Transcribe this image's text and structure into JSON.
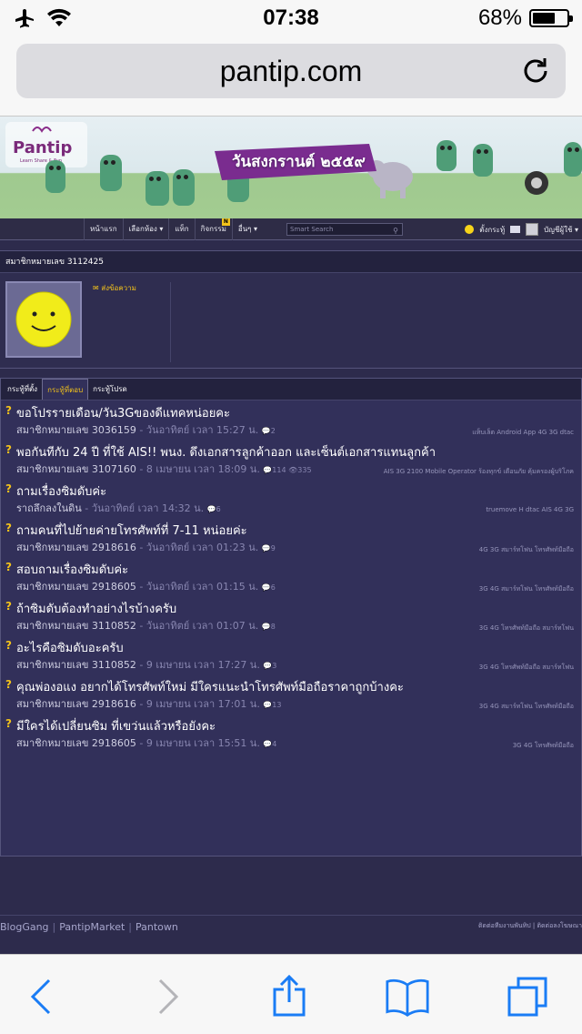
{
  "status_bar": {
    "time": "07:38",
    "battery_text": "68%",
    "battery_level": 0.68
  },
  "browser": {
    "url": "pantip.com"
  },
  "banner": {
    "logo_text": "Pantip",
    "logo_sub": "Learn Share & Fun",
    "ribbon_text": "วันสงกรานต์ ๒๕๕๙"
  },
  "nav": {
    "items": [
      {
        "label": "หน้าแรก"
      },
      {
        "label": "เลือกห้อง ▾"
      },
      {
        "label": "แท็ก"
      },
      {
        "label": "กิจกรรม",
        "badge": "N"
      },
      {
        "label": "อื่นๆ ▾"
      }
    ],
    "search_placeholder": "Smart Search",
    "post_label": "ตั้งกระทู้",
    "account_label": "บัญชีผู้ใช้ ▾"
  },
  "profile": {
    "member_title": "สมาชิกหมายเลข 3112425",
    "send_message": "ส่งข้อความ"
  },
  "tabs": [
    {
      "label": "กระทู้ที่ตั้ง"
    },
    {
      "label": "กระทู้ที่ตอบ"
    },
    {
      "label": "กระทู้โปรด"
    }
  ],
  "topics": [
    {
      "title": "ขอโปรรายเดือน/วัน3Gของดีแทคหน่อยคะ",
      "author": "สมาชิกหมายเลข 3036159",
      "when": " - วันอาทิตย์ เวลา 15:27 น.",
      "stats": "💬2",
      "tags": "แท็บเล็ต  Android App  4G  3G  dtac"
    },
    {
      "title": "พอกันทีกับ 24 ปี ที่ใช้ AIS!! พนง. ดึงเอกสารลูกค้าออก และเซ็นต์เอกสารแทนลูกค้า",
      "author": "สมาชิกหมายเลข 3107160",
      "when": " - 8 เมษายน เวลา 18:09 น.",
      "stats": "💬114  👁335",
      "tags": "AIS 3G 2100  Mobile Operator  ร้องทุกข์  เตือนภัย  คุ้มครองผู้บริโภค"
    },
    {
      "title": "ถามเรื่องซิมดับค่ะ",
      "author": "ราถลึกลงในดิน",
      "when": " - วันอาทิตย์ เวลา 14:32 น.",
      "stats": "💬6",
      "tags": "truemove H  dtac  AIS  4G  3G"
    },
    {
      "title": "ถามคนที่ไปย้ายค่ายโทรศัพท์ที่ 7-11 หน่อยค่ะ",
      "author": "สมาชิกหมายเลข 2918616",
      "when": " - วันอาทิตย์ เวลา 01:23 น.",
      "stats": "💬9",
      "tags": "4G  3G  สมาร์ทโฟน  โทรศัพท์มือถือ"
    },
    {
      "title": "สอบถามเรื่องซิมดับค่ะ",
      "author": "สมาชิกหมายเลข 2918605",
      "when": " - วันอาทิตย์ เวลา 01:15 น.",
      "stats": "💬6",
      "tags": "3G  4G  สมาร์ทโฟน  โทรศัพท์มือถือ"
    },
    {
      "title": "ถ้าซิมดับต้องทำอย่างไรบ้างครับ",
      "author": "สมาชิกหมายเลข 3110852",
      "when": " - วันอาทิตย์ เวลา 01:07 น.",
      "stats": "💬8",
      "tags": "3G  4G  โทรศัพท์มือถือ  สมาร์ทโฟน"
    },
    {
      "title": "อะไรคือซิมดับอะครับ",
      "author": "สมาชิกหมายเลข 3110852",
      "when": " - 9 เมษายน เวลา 17:27 น.",
      "stats": "💬3",
      "tags": "3G  4G  โทรศัพท์มือถือ  สมาร์ทโฟน"
    },
    {
      "title": "คุณพ่องอแง อยากได้โทรศัพท์ใหม่ มีใครแนะนำโทรศัพท์มือถือราคาถูกบ้างคะ",
      "author": "สมาชิกหมายเลข 2918616",
      "when": " - 9 เมษายน เวลา 17:01 น.",
      "stats": "💬13",
      "tags": "3G  4G  สมาร์ทโฟน  โทรศัพท์มือถือ"
    },
    {
      "title": "มีใครได้เปลี่ยนซิม ที่เขว่นแล้วหรือยังคะ",
      "author": "สมาชิกหมายเลข 2918605",
      "when": " - 9 เมษายน เวลา 15:51 น.",
      "stats": "💬4",
      "tags": "3G  4G  โทรศัพท์มือถือ"
    }
  ],
  "footer": {
    "links": [
      {
        "label": "BlogGang"
      },
      {
        "label": "PantipMarket"
      },
      {
        "label": "Pantown"
      }
    ],
    "right_links": "ติดต่อทีมงานพันทิป  |  ติดต่อลงโฆษณา"
  },
  "icons": {
    "airplane": "airplane-icon",
    "wifi": "wifi-icon",
    "reload": "reload-icon",
    "back": "back-icon",
    "forward": "forward-icon",
    "share": "share-icon",
    "bookmarks": "bookmarks-icon",
    "tabs": "tabs-icon"
  },
  "colors": {
    "accent": "#f2c21b",
    "page_bg": "#2d2b4c",
    "ios_blue": "#1a7cf5"
  }
}
